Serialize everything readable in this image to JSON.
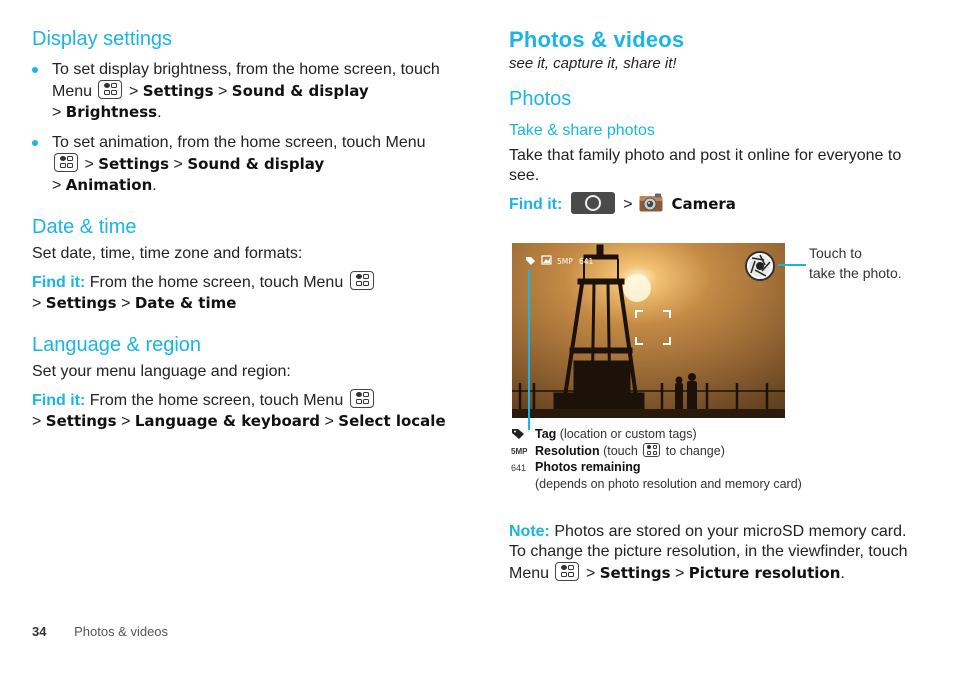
{
  "left": {
    "display": {
      "heading": "Display settings",
      "items": [
        {
          "text1": "To set display brightness, from the home screen, touch Menu",
          "path": [
            "Settings",
            "Sound & display",
            "Brightness"
          ]
        },
        {
          "text1": "To set animation, from the home screen, touch Menu",
          "path": [
            "Settings",
            "Sound & display",
            "Animation"
          ]
        }
      ]
    },
    "date": {
      "heading": "Date & time",
      "desc": "Set date, time, time zone and formats:",
      "find_label": "Find it:",
      "find_text": "From the home screen, touch Menu",
      "path": [
        "Settings",
        "Date & time"
      ]
    },
    "language": {
      "heading": "Language & region",
      "desc": "Set your menu language and region:",
      "find_label": "Find it:",
      "find_text": "From the home screen, touch Menu",
      "path": [
        "Settings",
        "Language & keyboard",
        "Select locale"
      ]
    }
  },
  "right": {
    "title": "Photos & videos",
    "tagline": "see it, capture it, share it!",
    "photos_heading": "Photos",
    "sub_heading": "Take & share photos",
    "desc": "Take that family photo and post it online for everyone to see.",
    "find_label": "Find it:",
    "find_target": "Camera",
    "viewfinder": {
      "resolution": "5MP",
      "remaining": "641",
      "callout": [
        "Touch to",
        "take the photo."
      ]
    },
    "legend": [
      {
        "icon": "tag-icon",
        "bold": "Tag",
        "rest": "(location or custom tags)"
      },
      {
        "label": "5MP",
        "bold": "Resolution",
        "rest_a": "(touch",
        "rest_b": "to change)"
      },
      {
        "label": "641",
        "bold": "Photos remaining",
        "rest": "(depends on photo resolution and memory card)"
      }
    ],
    "note": {
      "label": "Note:",
      "text": "Photos are stored on your microSD memory card. To change the picture resolution, in the viewfinder, touch Menu",
      "path": [
        "Settings",
        "Picture resolution"
      ]
    }
  },
  "footer": {
    "page_number": "34",
    "section": "Photos & videos"
  },
  "colors": {
    "accent": "#19b4e8"
  }
}
